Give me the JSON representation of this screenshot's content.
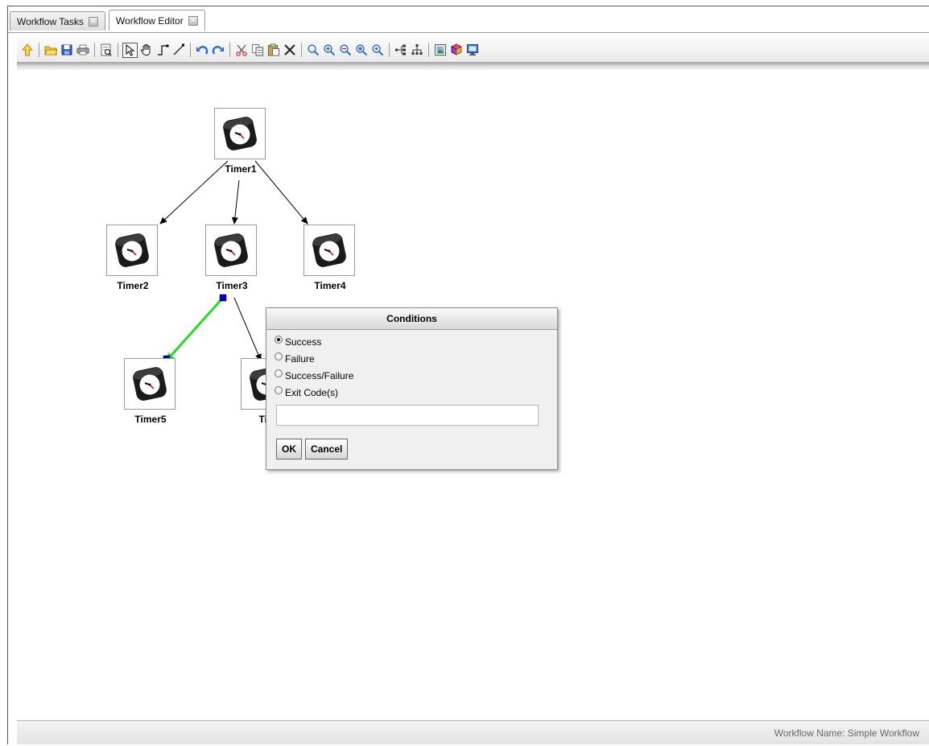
{
  "tabs": [
    {
      "label": "Workflow Tasks",
      "active": false
    },
    {
      "label": "Workflow Editor",
      "active": true
    }
  ],
  "toolbar": {
    "icons": [
      "up-arrow-icon",
      "open-folder-icon",
      "save-icon",
      "print-icon",
      "print-preview-icon",
      "select-pointer-icon",
      "pan-hand-icon",
      "orthogonal-connector-icon",
      "straight-connector-icon",
      "undo-icon",
      "redo-icon",
      "cut-icon",
      "copy-icon",
      "paste-icon",
      "delete-icon",
      "zoom-icon",
      "zoom-in-icon",
      "zoom-out-icon",
      "zoom-actual-icon",
      "zoom-fit-icon",
      "horizontal-layout-icon",
      "tree-layout-icon",
      "export-image-icon",
      "book-icon",
      "monitor-icon"
    ]
  },
  "nodes": [
    {
      "id": "timer1",
      "label": "Timer1"
    },
    {
      "id": "timer2",
      "label": "Timer2"
    },
    {
      "id": "timer3",
      "label": "Timer3"
    },
    {
      "id": "timer4",
      "label": "Timer4"
    },
    {
      "id": "timer5",
      "label": "Timer5"
    },
    {
      "id": "timer6",
      "label": "Tim"
    }
  ],
  "colors": {
    "selected_edge": "#22dd22",
    "handle": "#0000cc"
  },
  "dialog": {
    "title": "Conditions",
    "options": [
      {
        "label": "Success",
        "checked": true
      },
      {
        "label": "Failure",
        "checked": false
      },
      {
        "label": "Success/Failure",
        "checked": false
      },
      {
        "label": "Exit Code(s)",
        "checked": false
      }
    ],
    "exit_codes_value": "",
    "ok_label": "OK",
    "cancel_label": "Cancel"
  },
  "status": {
    "text": "Workflow Name: Simple Workflow"
  }
}
